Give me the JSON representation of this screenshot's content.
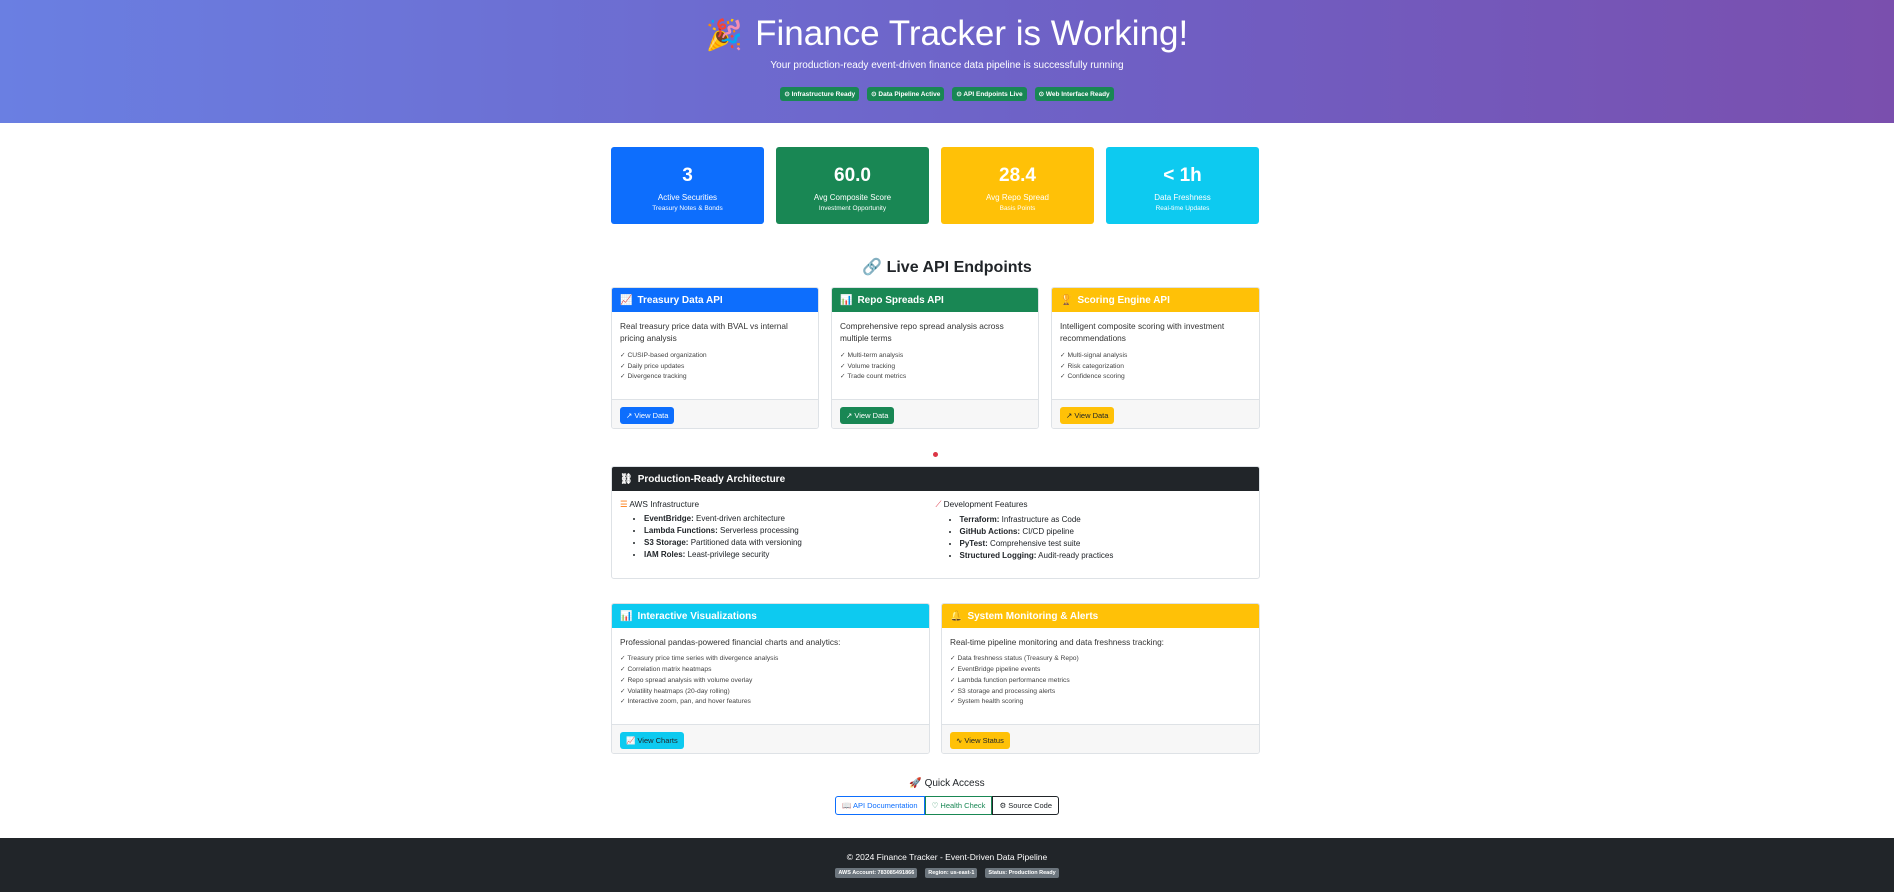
{
  "hero": {
    "title": "Finance Tracker is Working!",
    "subtitle": "Your production-ready event-driven finance data pipeline is successfully running",
    "badges": [
      "Infrastructure Ready",
      "Data Pipeline Active",
      "API Endpoints Live",
      "Web Interface Ready"
    ]
  },
  "stats": [
    {
      "value": "3",
      "label": "Active Securities",
      "sub": "Treasury Notes & Bonds",
      "color": "#0d6efd"
    },
    {
      "value": "60.0",
      "label": "Avg Composite Score",
      "sub": "Investment Opportunity",
      "color": "#198754"
    },
    {
      "value": "28.4",
      "label": "Avg Repo Spread",
      "sub": "Basis Points",
      "color": "#ffc107"
    },
    {
      "value": "< 1h",
      "label": "Data Freshness",
      "sub": "Real-time Updates",
      "color": "#0dcaf0"
    }
  ],
  "api_section": {
    "title": "Live API Endpoints"
  },
  "api_cards": [
    {
      "title": "Treasury Data API",
      "desc": "Real treasury price data with BVAL vs internal pricing analysis",
      "items": [
        "✓ CUSIP-based organization",
        "✓ Daily price updates",
        "✓ Divergence tracking"
      ],
      "button": "View Data"
    },
    {
      "title": "Repo Spreads API",
      "desc": "Comprehensive repo spread analysis across multiple terms",
      "items": [
        "✓ Multi-term analysis",
        "✓ Volume tracking",
        "✓ Trade count metrics"
      ],
      "button": "View Data"
    },
    {
      "title": "Scoring Engine API",
      "desc": "Intelligent composite scoring with investment recommendations",
      "items": [
        "✓ Multi-signal analysis",
        "✓ Risk categorization",
        "✓ Confidence scoring"
      ],
      "button": "View Data"
    }
  ],
  "architecture": {
    "title": "Production-Ready Architecture",
    "aws": {
      "heading": "AWS Infrastructure",
      "items": [
        {
          "k": "EventBridge:",
          "v": "Event-driven architecture"
        },
        {
          "k": "Lambda Functions:",
          "v": "Serverless processing"
        },
        {
          "k": "S3 Storage:",
          "v": "Partitioned data with versioning"
        },
        {
          "k": "IAM Roles:",
          "v": "Least-privilege security"
        }
      ]
    },
    "dev": {
      "heading": "Development Features",
      "items": [
        {
          "k": "Terraform:",
          "v": "Infrastructure as Code"
        },
        {
          "k": "GitHub Actions:",
          "v": "CI/CD pipeline"
        },
        {
          "k": "PyTest:",
          "v": "Comprehensive test suite"
        },
        {
          "k": "Structured Logging:",
          "v": "Audit-ready practices"
        }
      ]
    }
  },
  "viz": {
    "title": "Interactive Visualizations",
    "desc": "Professional pandas-powered financial charts and analytics:",
    "items": [
      "✓ Treasury price time series with divergence analysis",
      "✓ Correlation matrix heatmaps",
      "✓ Repo spread analysis with volume overlay",
      "✓ Volatility heatmaps (20-day rolling)",
      "✓ Interactive zoom, pan, and hover features"
    ],
    "button": "View Charts"
  },
  "monitor": {
    "title": "System Monitoring & Alerts",
    "desc": "Real-time pipeline monitoring and data freshness tracking:",
    "items": [
      "✓ Data freshness status (Treasury & Repo)",
      "✓ EventBridge pipeline events",
      "✓ Lambda function performance metrics",
      "✓ S3 storage and processing alerts",
      "✓ System health scoring"
    ],
    "button": "View Status"
  },
  "quick": {
    "title": "Quick Access",
    "buttons": [
      "API Documentation",
      "Health Check",
      "Source Code"
    ]
  },
  "footer": {
    "copyright": "© 2024 Finance Tracker - Event-Driven Data Pipeline",
    "badges": [
      "AWS Account: 783085491866",
      "Region: us-east-1",
      "Status: Production Ready"
    ]
  }
}
